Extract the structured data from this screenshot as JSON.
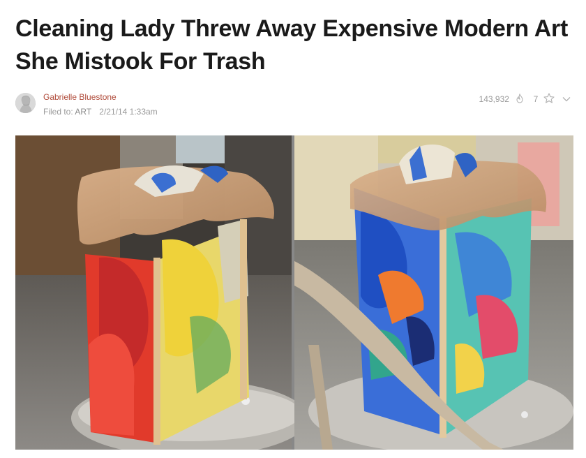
{
  "article": {
    "headline_line1": "Cleaning Lady Threw Away Expensive Modern Art",
    "headline_line2": "She Mistook For Trash"
  },
  "byline": {
    "author": "Gabrielle Bluestone",
    "filed_prefix": "Filed to:",
    "category": "ART",
    "date": "2/21/14 1:33am"
  },
  "stats": {
    "views": "143,932",
    "stars": "7",
    "icons": [
      "flame-icon",
      "star-outline-icon",
      "chevron-down-icon"
    ]
  },
  "image": {
    "description_icons": [
      "left-trash-can-artwork",
      "right-trash-can-artwork"
    ]
  }
}
